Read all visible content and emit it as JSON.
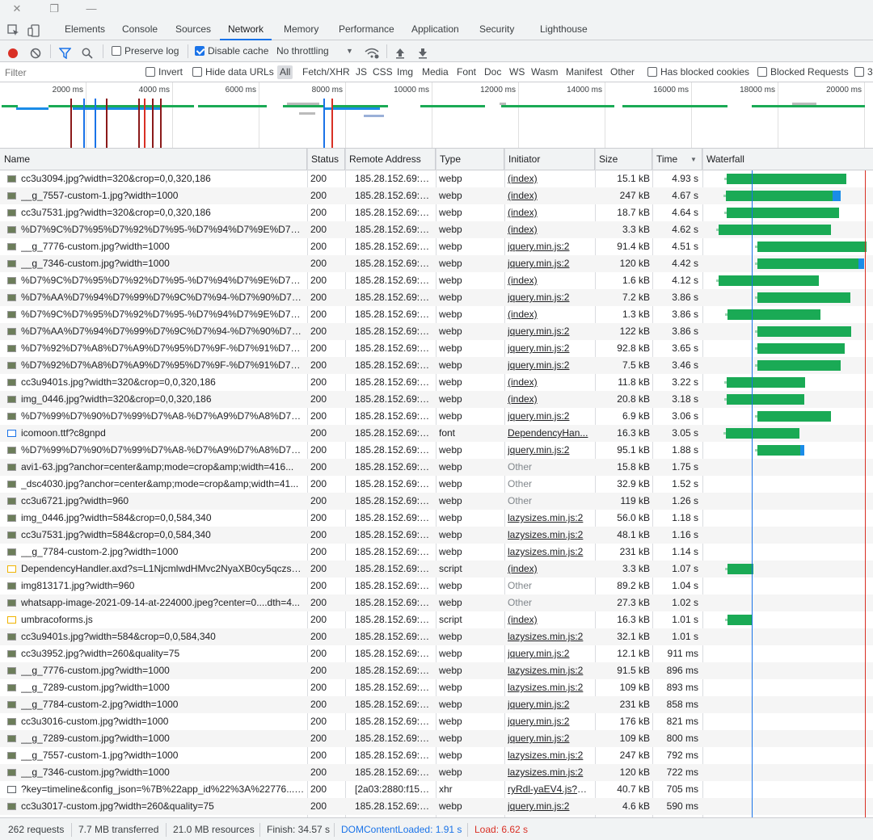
{
  "window": {
    "close_icon": "close-icon",
    "restore_icon": "restore-icon",
    "minimize_icon": "minimize-icon"
  },
  "tabs": [
    {
      "label": "Elements"
    },
    {
      "label": "Console"
    },
    {
      "label": "Sources"
    },
    {
      "label": "Network",
      "active": true
    },
    {
      "label": "Memory"
    },
    {
      "label": "Performance"
    },
    {
      "label": "Application"
    },
    {
      "label": "Security"
    },
    {
      "label": "Lighthouse"
    }
  ],
  "toolbar": {
    "preserve_log": "Preserve log",
    "disable_cache": "Disable cache",
    "throttling": "No throttling"
  },
  "filter": {
    "placeholder": "Filter",
    "invert": "Invert",
    "hide_data_urls": "Hide data URLs",
    "types": [
      "All",
      "Fetch/XHR",
      "JS",
      "CSS",
      "Img",
      "Media",
      "Font",
      "Doc",
      "WS",
      "Wasm",
      "Manifest",
      "Other"
    ],
    "has_blocked_cookies": "Has blocked cookies",
    "blocked_requests": "Blocked Requests",
    "third_party": "3"
  },
  "overview": {
    "ticks": [
      "2000 ms",
      "4000 ms",
      "6000 ms",
      "8000 ms",
      "10000 ms",
      "12000 ms",
      "14000 ms",
      "16000 ms",
      "18000 ms",
      "20000 ms"
    ]
  },
  "columns": {
    "name": "Name",
    "status": "Status",
    "remote": "Remote Address",
    "type": "Type",
    "initiator": "Initiator",
    "size": "Size",
    "time": "Time",
    "waterfall": "Waterfall"
  },
  "rows": [
    {
      "name": "cc3u3094.jpg?width=320&crop=0,0,320,186",
      "status": "200",
      "remote": "185.28.152.69:443",
      "type": "webp",
      "initiator": "(index)",
      "size": "15.1 kB",
      "time": "4.93 s"
    },
    {
      "name": "__g_7557-custom-1.jpg?width=1000",
      "status": "200",
      "remote": "185.28.152.69:443",
      "type": "webp",
      "initiator": "(index)",
      "size": "247 kB",
      "time": "4.67 s"
    },
    {
      "name": "cc3u7531.jpg?width=320&crop=0,0,320,186",
      "status": "200",
      "remote": "185.28.152.69:443",
      "type": "webp",
      "initiator": "(index)",
      "size": "18.7 kB",
      "time": "4.64 s"
    },
    {
      "name": "%D7%9C%D7%95%D7%92%D7%95-%D7%94%D7%9E%D7%A8...",
      "status": "200",
      "remote": "185.28.152.69:443",
      "type": "webp",
      "initiator": "(index)",
      "size": "3.3 kB",
      "time": "4.62 s"
    },
    {
      "name": "__g_7776-custom.jpg?width=1000",
      "status": "200",
      "remote": "185.28.152.69:443",
      "type": "webp",
      "initiator": "jquery.min.js:2",
      "size": "91.4 kB",
      "time": "4.51 s"
    },
    {
      "name": "__g_7346-custom.jpg?width=1000",
      "status": "200",
      "remote": "185.28.152.69:443",
      "type": "webp",
      "initiator": "jquery.min.js:2",
      "size": "120 kB",
      "time": "4.42 s"
    },
    {
      "name": "%D7%9C%D7%95%D7%92%D7%95-%D7%94%D7%9E%D7%A8...",
      "status": "200",
      "remote": "185.28.152.69:443",
      "type": "webp",
      "initiator": "(index)",
      "size": "1.6 kB",
      "time": "4.12 s"
    },
    {
      "name": "%D7%AA%D7%94%D7%99%D7%9C%D7%94-%D7%90%D7%9...",
      "status": "200",
      "remote": "185.28.152.69:443",
      "type": "webp",
      "initiator": "jquery.min.js:2",
      "size": "7.2 kB",
      "time": "3.86 s"
    },
    {
      "name": "%D7%9C%D7%95%D7%92%D7%95-%D7%94%D7%9E%D7%A8...",
      "status": "200",
      "remote": "185.28.152.69:443",
      "type": "webp",
      "initiator": "(index)",
      "size": "1.3 kB",
      "time": "3.86 s"
    },
    {
      "name": "%D7%AA%D7%94%D7%99%D7%9C%D7%94-%D7%90%D7%9...",
      "status": "200",
      "remote": "185.28.152.69:443",
      "type": "webp",
      "initiator": "jquery.min.js:2",
      "size": "122 kB",
      "time": "3.86 s"
    },
    {
      "name": "%D7%92%D7%A8%D7%A9%D7%95%D7%9F-%D7%91%D7%A8...",
      "status": "200",
      "remote": "185.28.152.69:443",
      "type": "webp",
      "initiator": "jquery.min.js:2",
      "size": "92.8 kB",
      "time": "3.65 s"
    },
    {
      "name": "%D7%92%D7%A8%D7%A9%D7%95%D7%9F-%D7%91%D7%A8...",
      "status": "200",
      "remote": "185.28.152.69:443",
      "type": "webp",
      "initiator": "jquery.min.js:2",
      "size": "7.5 kB",
      "time": "3.46 s"
    },
    {
      "name": "cc3u9401s.jpg?width=320&crop=0,0,320,186",
      "status": "200",
      "remote": "185.28.152.69:443",
      "type": "webp",
      "initiator": "(index)",
      "size": "11.8 kB",
      "time": "3.22 s"
    },
    {
      "name": "img_0446.jpg?width=320&crop=0,0,320,186",
      "status": "200",
      "remote": "185.28.152.69:443",
      "type": "webp",
      "initiator": "(index)",
      "size": "20.8 kB",
      "time": "3.18 s"
    },
    {
      "name": "%D7%99%D7%90%D7%99%D7%A8-%D7%A9%D7%A8%D7%9...",
      "status": "200",
      "remote": "185.28.152.69:443",
      "type": "webp",
      "initiator": "jquery.min.js:2",
      "size": "6.9 kB",
      "time": "3.06 s"
    },
    {
      "name": "icomoon.ttf?c8gnpd",
      "status": "200",
      "remote": "185.28.152.69:443",
      "type": "font",
      "initiator": "DependencyHan...",
      "size": "16.3 kB",
      "time": "3.05 s"
    },
    {
      "name": "%D7%99%D7%90%D7%99%D7%A8-%D7%A9%D7%A8%D7%9...",
      "status": "200",
      "remote": "185.28.152.69:443",
      "type": "webp",
      "initiator": "jquery.min.js:2",
      "size": "95.1 kB",
      "time": "1.88 s"
    },
    {
      "name": "avi1-63.jpg?anchor=center&amp;mode=crop&amp;width=416...",
      "status": "200",
      "remote": "185.28.152.69:443",
      "type": "webp",
      "initiator": "Other",
      "size": "15.8 kB",
      "time": "1.75 s"
    },
    {
      "name": "_dsc4030.jpg?anchor=center&amp;mode=crop&amp;width=41...",
      "status": "200",
      "remote": "185.28.152.69:443",
      "type": "webp",
      "initiator": "Other",
      "size": "32.9 kB",
      "time": "1.52 s"
    },
    {
      "name": "cc3u6721.jpg?width=960",
      "status": "200",
      "remote": "185.28.152.69:443",
      "type": "webp",
      "initiator": "Other",
      "size": "119 kB",
      "time": "1.26 s"
    },
    {
      "name": "img_0446.jpg?width=584&crop=0,0,584,340",
      "status": "200",
      "remote": "185.28.152.69:443",
      "type": "webp",
      "initiator": "lazysizes.min.js:2",
      "size": "56.0 kB",
      "time": "1.18 s"
    },
    {
      "name": "cc3u7531.jpg?width=584&crop=0,0,584,340",
      "status": "200",
      "remote": "185.28.152.69:443",
      "type": "webp",
      "initiator": "lazysizes.min.js:2",
      "size": "48.1 kB",
      "time": "1.16 s"
    },
    {
      "name": "__g_7784-custom-2.jpg?width=1000",
      "status": "200",
      "remote": "185.28.152.69:443",
      "type": "webp",
      "initiator": "lazysizes.min.js:2",
      "size": "231 kB",
      "time": "1.14 s"
    },
    {
      "name": "DependencyHandler.axd?s=L1NjcmlwdHMvc2NyaXB0cy5qczs&t...",
      "status": "200",
      "remote": "185.28.152.69:443",
      "type": "script",
      "initiator": "(index)",
      "size": "3.3 kB",
      "time": "1.07 s"
    },
    {
      "name": "img813171.jpg?width=960",
      "status": "200",
      "remote": "185.28.152.69:443",
      "type": "webp",
      "initiator": "Other",
      "size": "89.2 kB",
      "time": "1.04 s"
    },
    {
      "name": "whatsapp-image-2021-09-14-at-224000.jpeg?center=0....dth=4...",
      "status": "200",
      "remote": "185.28.152.69:443",
      "type": "webp",
      "initiator": "Other",
      "size": "27.3 kB",
      "time": "1.02 s"
    },
    {
      "name": "umbracoforms.js",
      "status": "200",
      "remote": "185.28.152.69:443",
      "type": "script",
      "initiator": "(index)",
      "size": "16.3 kB",
      "time": "1.01 s"
    },
    {
      "name": "cc3u9401s.jpg?width=584&crop=0,0,584,340",
      "status": "200",
      "remote": "185.28.152.69:443",
      "type": "webp",
      "initiator": "lazysizes.min.js:2",
      "size": "32.1 kB",
      "time": "1.01 s"
    },
    {
      "name": "cc3u3952.jpg?width=260&quality=75",
      "status": "200",
      "remote": "185.28.152.69:443",
      "type": "webp",
      "initiator": "jquery.min.js:2",
      "size": "12.1 kB",
      "time": "911 ms"
    },
    {
      "name": "__g_7776-custom.jpg?width=1000",
      "status": "200",
      "remote": "185.28.152.69:443",
      "type": "webp",
      "initiator": "lazysizes.min.js:2",
      "size": "91.5 kB",
      "time": "896 ms"
    },
    {
      "name": "__g_7289-custom.jpg?width=1000",
      "status": "200",
      "remote": "185.28.152.69:443",
      "type": "webp",
      "initiator": "lazysizes.min.js:2",
      "size": "109 kB",
      "time": "893 ms"
    },
    {
      "name": "__g_7784-custom-2.jpg?width=1000",
      "status": "200",
      "remote": "185.28.152.69:443",
      "type": "webp",
      "initiator": "jquery.min.js:2",
      "size": "231 kB",
      "time": "858 ms"
    },
    {
      "name": "cc3u3016-custom.jpg?width=1000",
      "status": "200",
      "remote": "185.28.152.69:443",
      "type": "webp",
      "initiator": "jquery.min.js:2",
      "size": "176 kB",
      "time": "821 ms"
    },
    {
      "name": "__g_7289-custom.jpg?width=1000",
      "status": "200",
      "remote": "185.28.152.69:443",
      "type": "webp",
      "initiator": "jquery.min.js:2",
      "size": "109 kB",
      "time": "800 ms"
    },
    {
      "name": "__g_7557-custom-1.jpg?width=1000",
      "status": "200",
      "remote": "185.28.152.69:443",
      "type": "webp",
      "initiator": "lazysizes.min.js:2",
      "size": "247 kB",
      "time": "792 ms"
    },
    {
      "name": "__g_7346-custom.jpg?width=1000",
      "status": "200",
      "remote": "185.28.152.69:443",
      "type": "webp",
      "initiator": "lazysizes.min.js:2",
      "size": "120 kB",
      "time": "722 ms"
    },
    {
      "name": "?key=timeline&config_json=%7B%22app_id%22%3A%22776...0...",
      "status": "200",
      "remote": "[2a03:2880:f158:8....",
      "type": "xhr",
      "initiator": "ryRdl-yaEV4.js?_n...",
      "size": "40.7 kB",
      "time": "705 ms"
    },
    {
      "name": "cc3u3017-custom.jpg?width=260&quality=75",
      "status": "200",
      "remote": "185.28.152.69:443",
      "type": "webp",
      "initiator": "jquery.min.js:2",
      "size": "4.6 kB",
      "time": "590 ms"
    }
  ],
  "status_bar": {
    "requests": "262 requests",
    "transferred": "7.7 MB transferred",
    "resources": "21.0 MB resources",
    "finish": "Finish: 34.57 s",
    "dom_content_loaded": "DOMContentLoaded: 1.91 s",
    "load": "Load: 6.62 s"
  },
  "colors": {
    "accent": "#1a73e8",
    "record": "#d93025",
    "bar": "#1aaa55"
  }
}
